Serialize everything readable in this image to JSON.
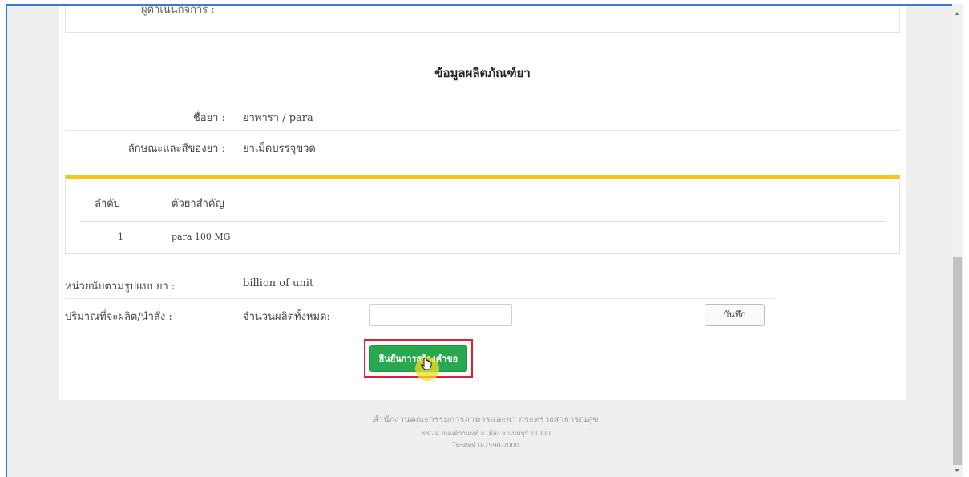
{
  "top_partial": {
    "text": "ผู้ดำเนินกิจการ :"
  },
  "section_title": "ข้อมูลผลิตภัณฑ์ยา",
  "drug_info": [
    {
      "label": "ชื่อยา :",
      "value": "ยาพารา / para"
    },
    {
      "label": "ลักษณะและสีของยา :",
      "value": "ยาเม็ดบรรจุขวด"
    }
  ],
  "ingredients": {
    "headers": [
      "ลำดับ",
      "ตัวยาสำคัญ"
    ],
    "rows": [
      [
        "1",
        "para 100 MG"
      ]
    ]
  },
  "unit": {
    "label": "หน่วยนับตามรูปแบบยา :",
    "value": "billion of unit"
  },
  "quantity": {
    "label": "ปริมาณที่จะผลิต/นำสั่ง :",
    "sub_label": "จำนวนผลิตทั้งหมด:",
    "input_value": "",
    "save_label": "บันทึก"
  },
  "confirm_label": "ยืนยันการสร้างคำขอ",
  "footer": {
    "line1": "สำนักงานคณะกรรมการอาหารและยา กระทรวงสาธารณสุข",
    "line2": "88/24 ถนนติวานนท์ อ.เมือง จ.นนทบุรี 11000",
    "line3": "โทรศัพท์ 0-2590-7000"
  },
  "colors": {
    "accent_yellow": "#f5c518",
    "confirm_green": "#2aa84f",
    "highlight_red": "#e0202a",
    "frame_blue": "#3c78d8"
  }
}
